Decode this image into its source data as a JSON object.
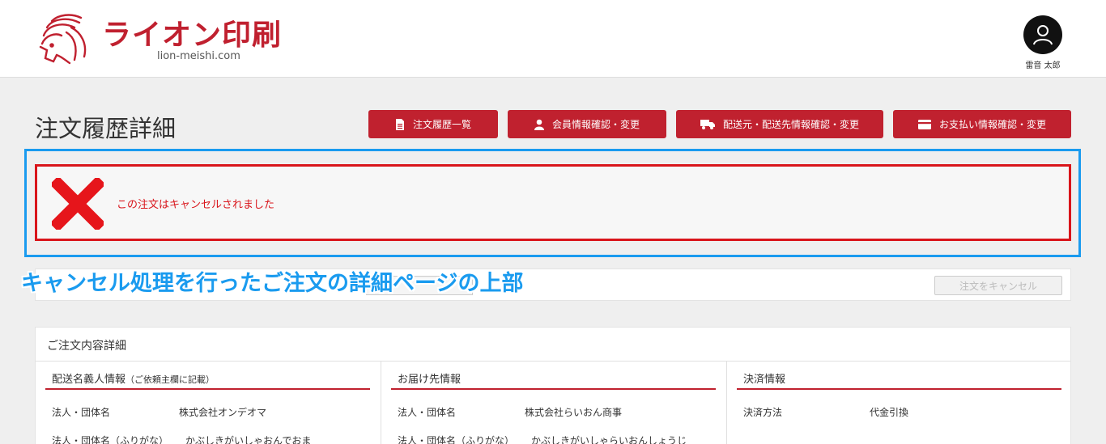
{
  "header": {
    "logo_text": "ライオン印刷",
    "logo_sub": "lion-meishi.com",
    "user_name": "雷音 太郎"
  },
  "page_title": "注文履歴詳細",
  "nav": [
    {
      "label": "注文履歴一覧",
      "icon": "document-icon"
    },
    {
      "label": "会員情報確認・変更",
      "icon": "user-icon"
    },
    {
      "label": "配送元・配送先情報確認・変更",
      "icon": "truck-icon"
    },
    {
      "label": "お支払い情報確認・変更",
      "icon": "credit-card-icon"
    }
  ],
  "cancel_notice": {
    "message": "この注文はキャンセルされました"
  },
  "annotation": "キャンセル処理を行ったご注文の詳細ページの上部",
  "action_bar": {
    "cancel_button": "注文をキャンセル"
  },
  "details": {
    "title": "ご注文内容詳細",
    "columns": [
      {
        "title": "配送名義人情報",
        "title_note": "（ご依頼主欄に記載）",
        "rows": [
          {
            "label": "法人・団体名",
            "value": "株式会社オンデオマ"
          },
          {
            "label": "法人・団体名（ふりがな）",
            "value": "かぶしきがいしゃおんでおま"
          }
        ]
      },
      {
        "title": "お届け先情報",
        "rows": [
          {
            "label": "法人・団体名",
            "value": "株式会社らいおん商事"
          },
          {
            "label": "法人・団体名（ふりがな）",
            "value": "かぶしきがいしゃらいおんしょうじ"
          }
        ]
      },
      {
        "title": "決済情報",
        "rows": [
          {
            "label": "決済方法",
            "value": "代金引換"
          }
        ]
      }
    ]
  },
  "colors": {
    "brand_red": "#c0212f",
    "cancel_red": "#d9151b",
    "annotation_blue": "#1a9bef"
  }
}
